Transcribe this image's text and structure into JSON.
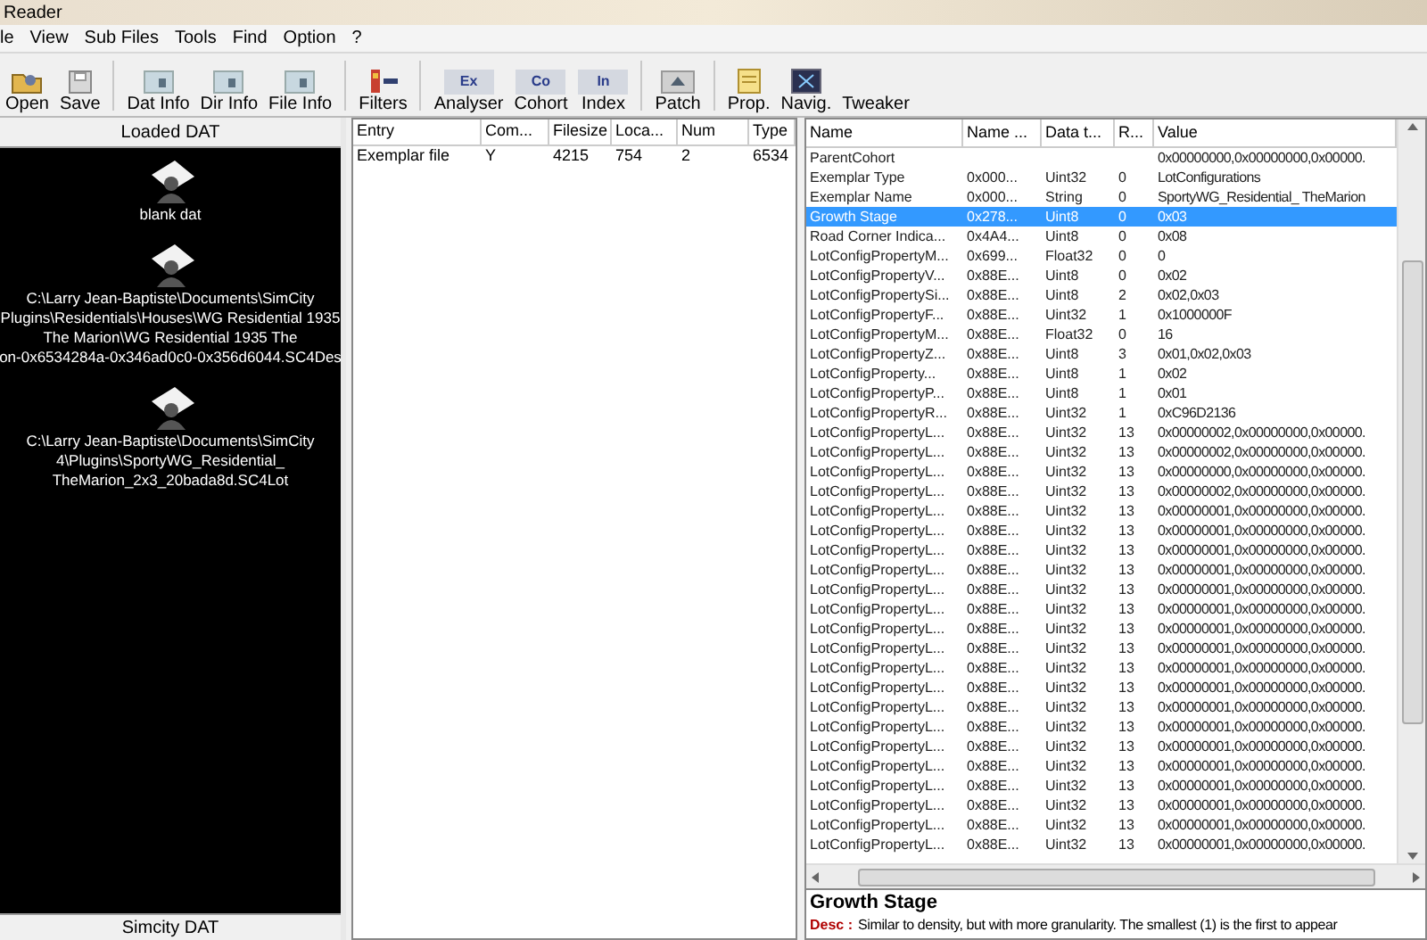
{
  "window": {
    "title": "Reader"
  },
  "menu": [
    "le",
    "View",
    "Sub Files",
    "Tools",
    "Find",
    "Option",
    "?"
  ],
  "toolbar": [
    [
      {
        "label": "Open",
        "kind": "folder"
      },
      {
        "label": "Save",
        "kind": "disk"
      }
    ],
    [
      {
        "label": "Dat Info",
        "kind": "doc"
      },
      {
        "label": "Dir Info",
        "kind": "doc"
      },
      {
        "label": "File Info",
        "kind": "doc"
      }
    ],
    [
      {
        "label": "Filters",
        "kind": "filter"
      }
    ],
    [
      {
        "label": "Analyser",
        "kind": "tile",
        "icon_text": "Ex"
      },
      {
        "label": "Cohort",
        "kind": "tile",
        "icon_text": "Co"
      },
      {
        "label": "Index",
        "kind": "tile",
        "icon_text": "In"
      }
    ],
    [
      {
        "label": "Patch",
        "kind": "patch"
      }
    ],
    [
      {
        "label": "Prop.",
        "kind": "note"
      },
      {
        "label": "Navig.",
        "kind": "nav"
      },
      {
        "label": "Tweaker",
        "kind": "none"
      }
    ]
  ],
  "loaded_panel": {
    "title": "Loaded DAT",
    "files": [
      {
        "lines": [
          "blank dat"
        ]
      },
      {
        "lines": [
          "C:\\Larry Jean-Baptiste\\Documents\\SimCity",
          "Plugins\\Residentials\\Houses\\WG Residential 1935",
          "The Marion\\WG Residential 1935 The",
          "on-0x6534284a-0x346ad0c0-0x356d6044.SC4Des"
        ]
      },
      {
        "lines": [
          "C:\\Larry Jean-Baptiste\\Documents\\SimCity",
          "4\\Plugins\\SportyWG_Residential_",
          "TheMarion_2x3_20bada8d.SC4Lot"
        ]
      }
    ],
    "footer": "Simcity DAT"
  },
  "entries": {
    "columns": [
      "Entry",
      "Com...",
      "Filesize",
      "Loca...",
      "Num",
      "Type"
    ],
    "rows": [
      [
        "Exemplar file",
        "Y",
        "4215",
        "754",
        "2",
        "6534"
      ]
    ]
  },
  "properties": {
    "columns": [
      "Name",
      "Name ...",
      "Data t...",
      "R...",
      "Value"
    ],
    "rows": [
      {
        "cells": [
          "ParentCohort",
          "",
          "",
          "",
          "0x00000000,0x00000000,0x00000."
        ],
        "selected": false
      },
      {
        "cells": [
          "Exemplar Type",
          "0x000...",
          "Uint32",
          "0",
          "LotConfigurations"
        ],
        "selected": false
      },
      {
        "cells": [
          "Exemplar Name",
          "0x000...",
          "String",
          "0",
          "SportyWG_Residential_ TheMarion"
        ],
        "selected": false
      },
      {
        "cells": [
          "Growth Stage",
          "0x278...",
          "Uint8",
          "0",
          "0x03"
        ],
        "selected": true
      },
      {
        "cells": [
          "Road Corner Indica...",
          "0x4A4...",
          "Uint8",
          "0",
          "0x08"
        ],
        "selected": false
      },
      {
        "cells": [
          "LotConfigPropertyM...",
          "0x699...",
          "Float32",
          "0",
          "0"
        ],
        "selected": false
      },
      {
        "cells": [
          "LotConfigPropertyV...",
          "0x88E...",
          "Uint8",
          "0",
          "0x02"
        ],
        "selected": false
      },
      {
        "cells": [
          "LotConfigPropertySi...",
          "0x88E...",
          "Uint8",
          "2",
          "0x02,0x03"
        ],
        "selected": false
      },
      {
        "cells": [
          "LotConfigPropertyF...",
          "0x88E...",
          "Uint32",
          "1",
          "0x1000000F"
        ],
        "selected": false
      },
      {
        "cells": [
          "LotConfigPropertyM...",
          "0x88E...",
          "Float32",
          "0",
          "16"
        ],
        "selected": false
      },
      {
        "cells": [
          "LotConfigPropertyZ...",
          "0x88E...",
          "Uint8",
          "3",
          "0x01,0x02,0x03"
        ],
        "selected": false
      },
      {
        "cells": [
          "LotConfigProperty...",
          "0x88E...",
          "Uint8",
          "1",
          "0x02"
        ],
        "selected": false
      },
      {
        "cells": [
          "LotConfigPropertyP...",
          "0x88E...",
          "Uint8",
          "1",
          "0x01"
        ],
        "selected": false
      },
      {
        "cells": [
          "LotConfigPropertyR...",
          "0x88E...",
          "Uint32",
          "1",
          "0xC96D2136"
        ],
        "selected": false
      },
      {
        "cells": [
          "LotConfigPropertyL...",
          "0x88E...",
          "Uint32",
          "13",
          "0x00000002,0x00000000,0x00000."
        ],
        "selected": false
      },
      {
        "cells": [
          "LotConfigPropertyL...",
          "0x88E...",
          "Uint32",
          "13",
          "0x00000002,0x00000000,0x00000."
        ],
        "selected": false
      },
      {
        "cells": [
          "LotConfigPropertyL...",
          "0x88E...",
          "Uint32",
          "13",
          "0x00000000,0x00000000,0x00000."
        ],
        "selected": false
      },
      {
        "cells": [
          "LotConfigPropertyL...",
          "0x88E...",
          "Uint32",
          "13",
          "0x00000002,0x00000000,0x00000."
        ],
        "selected": false
      },
      {
        "cells": [
          "LotConfigPropertyL...",
          "0x88E...",
          "Uint32",
          "13",
          "0x00000001,0x00000000,0x00000."
        ],
        "selected": false
      },
      {
        "cells": [
          "LotConfigPropertyL...",
          "0x88E...",
          "Uint32",
          "13",
          "0x00000001,0x00000000,0x00000."
        ],
        "selected": false
      },
      {
        "cells": [
          "LotConfigPropertyL...",
          "0x88E...",
          "Uint32",
          "13",
          "0x00000001,0x00000000,0x00000."
        ],
        "selected": false
      },
      {
        "cells": [
          "LotConfigPropertyL...",
          "0x88E...",
          "Uint32",
          "13",
          "0x00000001,0x00000000,0x00000."
        ],
        "selected": false
      },
      {
        "cells": [
          "LotConfigPropertyL...",
          "0x88E...",
          "Uint32",
          "13",
          "0x00000001,0x00000000,0x00000."
        ],
        "selected": false
      },
      {
        "cells": [
          "LotConfigPropertyL...",
          "0x88E...",
          "Uint32",
          "13",
          "0x00000001,0x00000000,0x00000."
        ],
        "selected": false
      },
      {
        "cells": [
          "LotConfigPropertyL...",
          "0x88E...",
          "Uint32",
          "13",
          "0x00000001,0x00000000,0x00000."
        ],
        "selected": false
      },
      {
        "cells": [
          "LotConfigPropertyL...",
          "0x88E...",
          "Uint32",
          "13",
          "0x00000001,0x00000000,0x00000."
        ],
        "selected": false
      },
      {
        "cells": [
          "LotConfigPropertyL...",
          "0x88E...",
          "Uint32",
          "13",
          "0x00000001,0x00000000,0x00000."
        ],
        "selected": false
      },
      {
        "cells": [
          "LotConfigPropertyL...",
          "0x88E...",
          "Uint32",
          "13",
          "0x00000001,0x00000000,0x00000."
        ],
        "selected": false
      },
      {
        "cells": [
          "LotConfigPropertyL...",
          "0x88E...",
          "Uint32",
          "13",
          "0x00000001,0x00000000,0x00000."
        ],
        "selected": false
      },
      {
        "cells": [
          "LotConfigPropertyL...",
          "0x88E...",
          "Uint32",
          "13",
          "0x00000001,0x00000000,0x00000."
        ],
        "selected": false
      },
      {
        "cells": [
          "LotConfigPropertyL...",
          "0x88E...",
          "Uint32",
          "13",
          "0x00000001,0x00000000,0x00000."
        ],
        "selected": false
      },
      {
        "cells": [
          "LotConfigPropertyL...",
          "0x88E...",
          "Uint32",
          "13",
          "0x00000001,0x00000000,0x00000."
        ],
        "selected": false
      },
      {
        "cells": [
          "LotConfigPropertyL...",
          "0x88E...",
          "Uint32",
          "13",
          "0x00000001,0x00000000,0x00000."
        ],
        "selected": false
      },
      {
        "cells": [
          "LotConfigPropertyL...",
          "0x88E...",
          "Uint32",
          "13",
          "0x00000001,0x00000000,0x00000."
        ],
        "selected": false
      },
      {
        "cells": [
          "LotConfigPropertyL...",
          "0x88E...",
          "Uint32",
          "13",
          "0x00000001,0x00000000,0x00000."
        ],
        "selected": false
      },
      {
        "cells": [
          "LotConfigPropertyL...",
          "0x88E...",
          "Uint32",
          "13",
          "0x00000001,0x00000000,0x00000."
        ],
        "selected": false
      }
    ],
    "description": {
      "title": "Growth Stage",
      "label": "Desc :",
      "text": "Similar to density, but with more granularity. The smallest (1) is the first to appear"
    }
  }
}
